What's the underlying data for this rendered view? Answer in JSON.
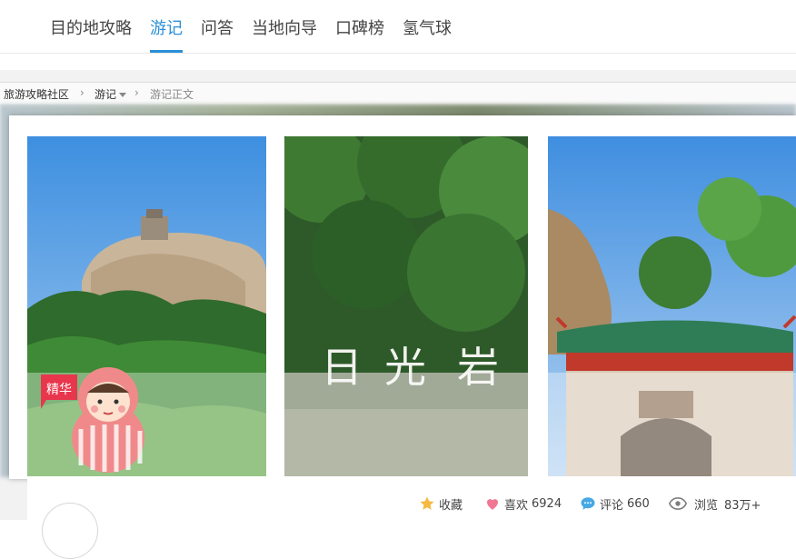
{
  "topnav": {
    "items": [
      {
        "label": "目的地攻略",
        "active": false
      },
      {
        "label": "游记",
        "active": true
      },
      {
        "label": "问答",
        "active": false
      },
      {
        "label": "当地向导",
        "active": false
      },
      {
        "label": "口碑榜",
        "active": false
      },
      {
        "label": "氢气球",
        "active": false
      }
    ]
  },
  "breadcrumb": {
    "items": [
      "旅游攻略社区",
      "游记",
      "游记正文"
    ]
  },
  "badge": {
    "label": "精华"
  },
  "stats": {
    "favorite": {
      "label": "收藏",
      "icon": "star-icon"
    },
    "like": {
      "label": "喜欢",
      "value": "6924",
      "icon": "heart-icon"
    },
    "comment": {
      "label": "评论",
      "value": "660",
      "icon": "comment-icon"
    },
    "view": {
      "label": "浏览",
      "value": "83万+",
      "icon": "eye-icon"
    }
  },
  "colors": {
    "accent": "#2a8fd8",
    "badge": "#e8374d",
    "star": "#f5b942",
    "heart": "#ef7791",
    "comment": "#47a8e5",
    "eye": "#7d7d7d"
  }
}
